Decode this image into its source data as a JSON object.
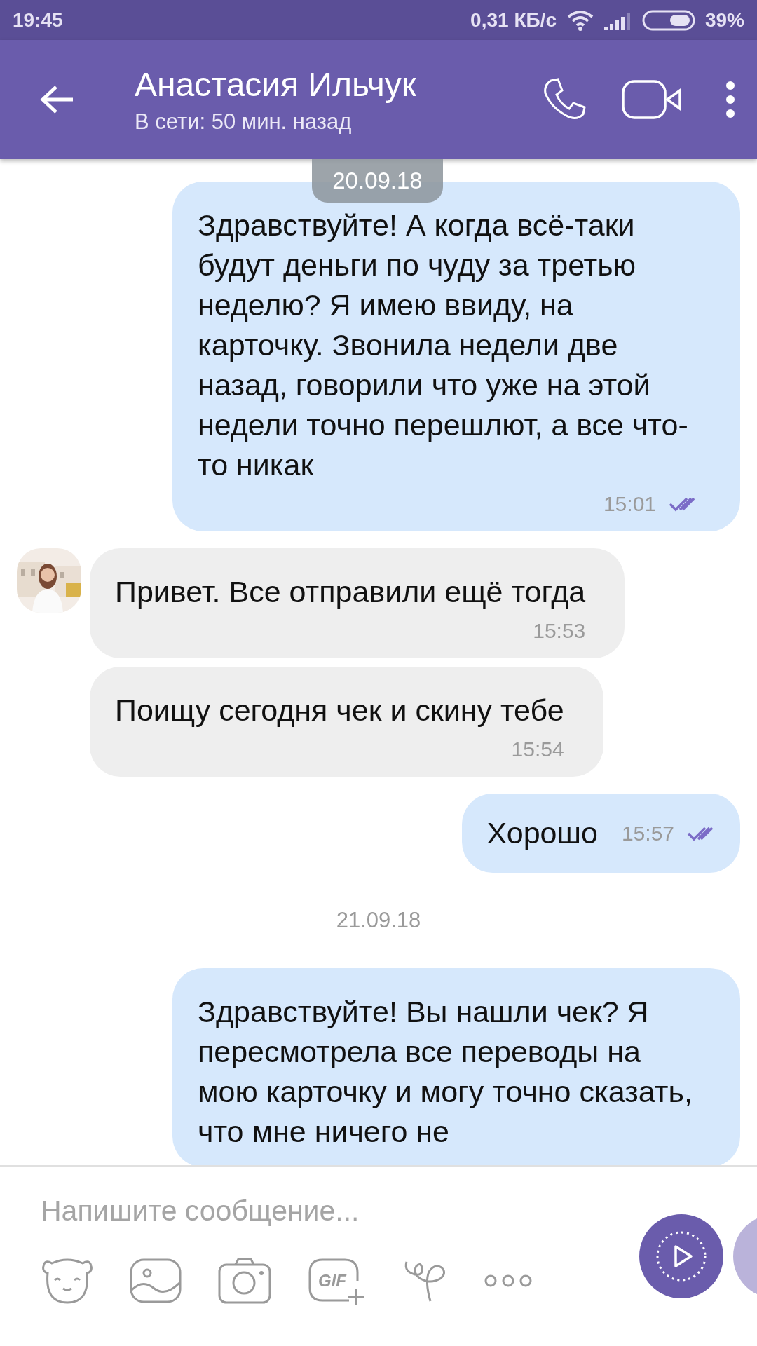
{
  "status_bar": {
    "time": "19:45",
    "speed": "0,31 КБ/с",
    "battery": "39%"
  },
  "header": {
    "name": "Анастасия Ильчук",
    "status": "В сети: 50 мин. назад"
  },
  "messages": [
    {
      "kind": "date",
      "text": "20.09.18",
      "floating": true
    },
    {
      "kind": "outgoing",
      "text": "Здравствуйте! А когда всё-таки будут деньги по чуду за третью неделю? Я имею ввиду, на карточку. Звонила недели две назад, говорили что уже на этой недели точно перешлют, а все что-то никак",
      "time": "15:01",
      "read": true
    },
    {
      "kind": "incoming",
      "text": "Привет. Все отправили ещё тогда",
      "time": "15:53",
      "avatar": true
    },
    {
      "kind": "incoming",
      "text": "Поищу сегодня чек и скину тебе",
      "time": "15:54",
      "avatar": false
    },
    {
      "kind": "outgoing",
      "text": "Хорошо",
      "time": "15:57",
      "read": true,
      "inline": true
    },
    {
      "kind": "date",
      "text": "21.09.18",
      "floating": false
    },
    {
      "kind": "outgoing",
      "text": "Здравствуйте! Вы нашли чек? Я пересмотрела все переводы на мою карточку и могу точно сказать, что мне ничего не"
    }
  ],
  "input": {
    "placeholder": "Напишите сообщение...",
    "gif_label": "GIF"
  }
}
